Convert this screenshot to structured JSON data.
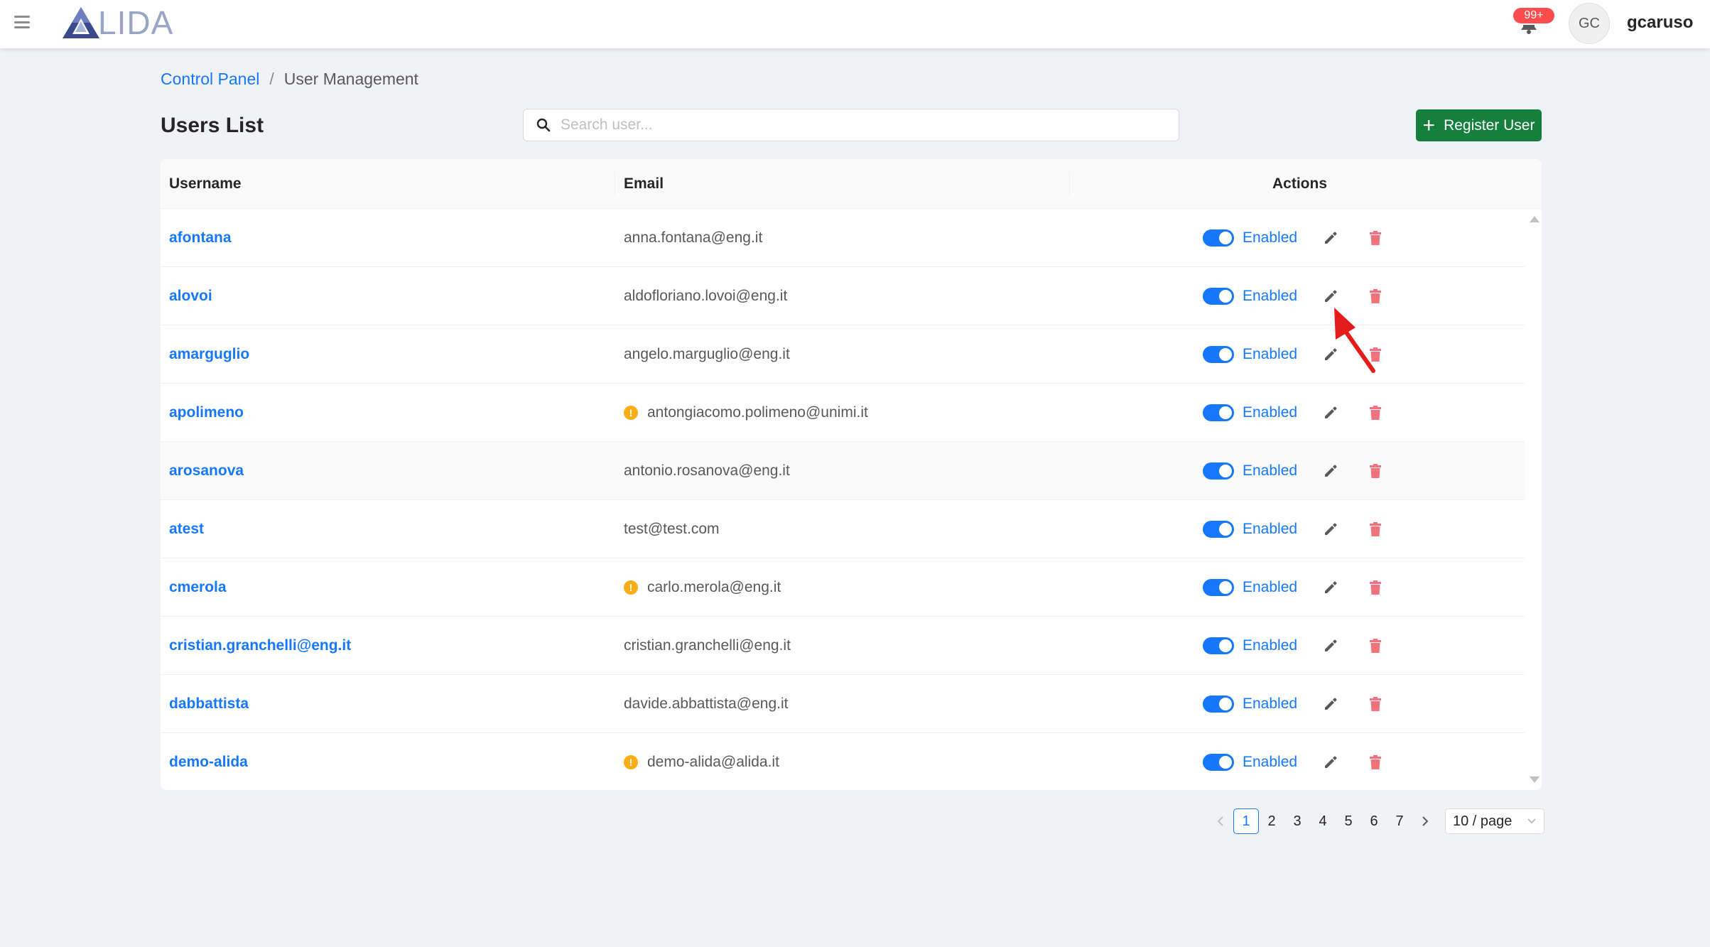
{
  "header": {
    "logo_text": "LIDA",
    "notification_badge": "99+",
    "avatar_initials": "GC",
    "username": "gcaruso"
  },
  "breadcrumb": {
    "parent": "Control Panel",
    "separator": "/",
    "current": "User Management"
  },
  "page": {
    "title": "Users List",
    "search_placeholder": "Search user...",
    "register_label": "Register User"
  },
  "table": {
    "columns": [
      "Username",
      "Email",
      "Actions"
    ],
    "rows": [
      {
        "username": "afontana",
        "email": "anna.fontana@eng.it",
        "warning": false,
        "status": "Enabled",
        "enabled": true
      },
      {
        "username": "alovoi",
        "email": "aldofloriano.lovoi@eng.it",
        "warning": false,
        "status": "Enabled",
        "enabled": true
      },
      {
        "username": "amarguglio",
        "email": "angelo.marguglio@eng.it",
        "warning": false,
        "status": "Enabled",
        "enabled": true
      },
      {
        "username": "apolimeno",
        "email": "antongiacomo.polimeno@unimi.it",
        "warning": true,
        "status": "Enabled",
        "enabled": true
      },
      {
        "username": "arosanova",
        "email": "antonio.rosanova@eng.it",
        "warning": false,
        "status": "Enabled",
        "enabled": true
      },
      {
        "username": "atest",
        "email": "test@test.com",
        "warning": false,
        "status": "Enabled",
        "enabled": true
      },
      {
        "username": "cmerola",
        "email": "carlo.merola@eng.it",
        "warning": true,
        "status": "Enabled",
        "enabled": true
      },
      {
        "username": "cristian.granchelli@eng.it",
        "email": "cristian.granchelli@eng.it",
        "warning": false,
        "status": "Enabled",
        "enabled": true
      },
      {
        "username": "dabbattista",
        "email": "davide.abbattista@eng.it",
        "warning": false,
        "status": "Enabled",
        "enabled": true
      },
      {
        "username": "demo-alida",
        "email": "demo-alida@alida.it",
        "warning": true,
        "status": "Enabled",
        "enabled": true
      }
    ]
  },
  "pagination": {
    "pages": [
      "1",
      "2",
      "3",
      "4",
      "5",
      "6",
      "7"
    ],
    "current_page": "1",
    "page_size": "10 / page"
  },
  "colors": {
    "accent": "#1677ff",
    "register_button": "#15803d",
    "delete_icon": "#f0727c",
    "warning": "#faad14",
    "badge": "#ff4d4f",
    "annotation_arrow": "#e31b1b"
  }
}
